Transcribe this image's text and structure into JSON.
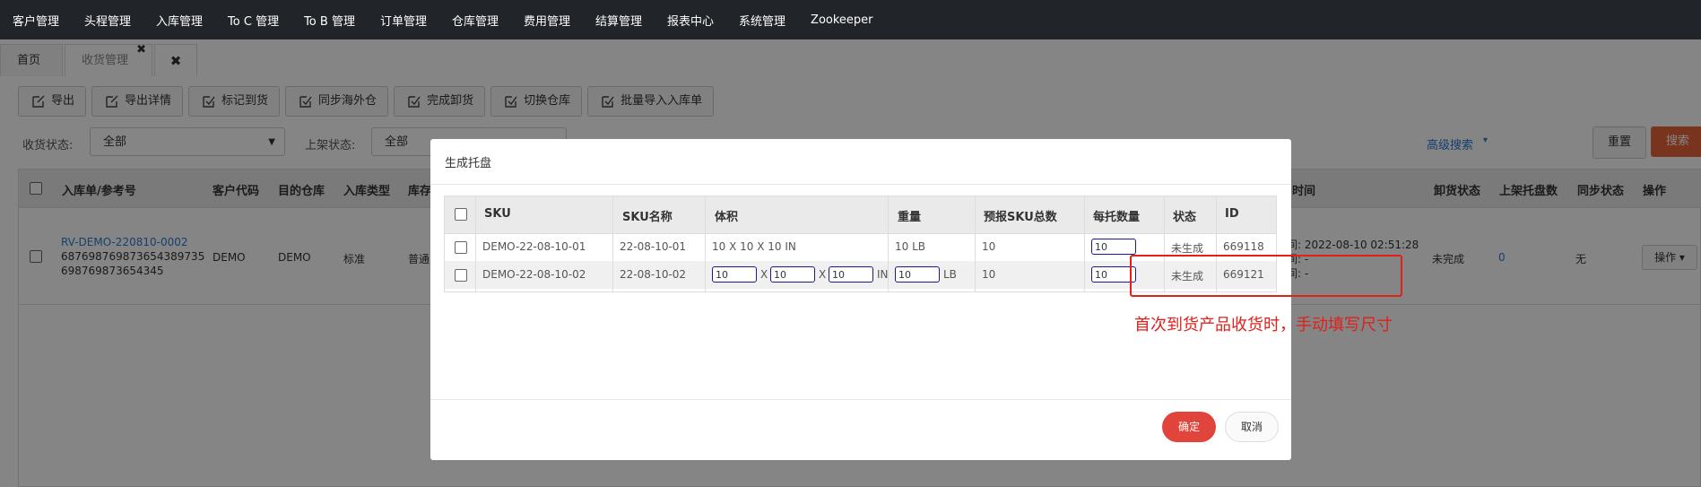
{
  "nav": [
    "客户管理",
    "头程管理",
    "入库管理",
    "To C 管理",
    "To B 管理",
    "订单管理",
    "仓库管理",
    "费用管理",
    "结算管理",
    "报表中心",
    "系统管理",
    "Zookeeper"
  ],
  "tabs": {
    "home": "首页",
    "receiving": "收货管理",
    "close_icon": "✖",
    "close_all_icon": "✖"
  },
  "toolbar": [
    "导出",
    "导出详情",
    "标记到货",
    "同步海外仓",
    "完成卸货",
    "切换仓库",
    "批量导入入库单"
  ],
  "filters": {
    "receive_status_label": "收货状态:",
    "receive_status_value": "全部",
    "shelf_status_label": "上架状态:",
    "shelf_status_value": "全部",
    "advanced": "高级搜索",
    "reset": "重置",
    "search": "搜索"
  },
  "table": {
    "headers": {
      "ref": "入库单/参考号",
      "customer": "客户代码",
      "warehouse": "目的仓库",
      "type": "入库类型",
      "inventory": "库存",
      "time": "时间",
      "unload": "卸货状态",
      "pallets": "上架托盘数",
      "sync": "同步状态",
      "ops": "操作"
    },
    "row": {
      "ref_link": "RV-DEMO-220810-0002",
      "ref_line2": "687698769873654389735",
      "ref_line3": "698769873654345",
      "customer": "DEMO",
      "warehouse": "DEMO",
      "type": "标准",
      "inventory": "普通",
      "time1": "间: 2022-08-10 02:51:28",
      "time2": "间: -",
      "time3": "间: -",
      "unload": "未完成",
      "pallets": "0",
      "sync": "无",
      "ops": "操作"
    }
  },
  "modal": {
    "title": "生成托盘",
    "headers": {
      "sku": "SKU",
      "sku_name": "SKU名称",
      "volume": "体积",
      "weight": "重量",
      "forecast": "预报SKU总数",
      "per_pallet": "每托数量",
      "status": "状态",
      "id": "ID"
    },
    "rows": [
      {
        "sku": "DEMO-22-08-10-01",
        "sku_name": "22-08-10-01",
        "volume": "10 X 10 X 10 IN",
        "weight": "10 LB",
        "forecast": "10",
        "per_pallet": "10",
        "status": "未生成",
        "id": "669118"
      },
      {
        "sku": "DEMO-22-08-10-02",
        "sku_name": "22-08-10-02",
        "dim_l": "10",
        "dim_w": "10",
        "dim_h": "10",
        "x1": "X",
        "x2": "X",
        "unit_in": "IN",
        "weight_val": "10",
        "unit_lb": "LB",
        "forecast": "10",
        "per_pallet": "10",
        "status": "未生成",
        "id": "669121"
      }
    ],
    "annotation": "首次到货产品收货时，手动填写尺寸",
    "ok": "确定",
    "cancel": "取消"
  }
}
